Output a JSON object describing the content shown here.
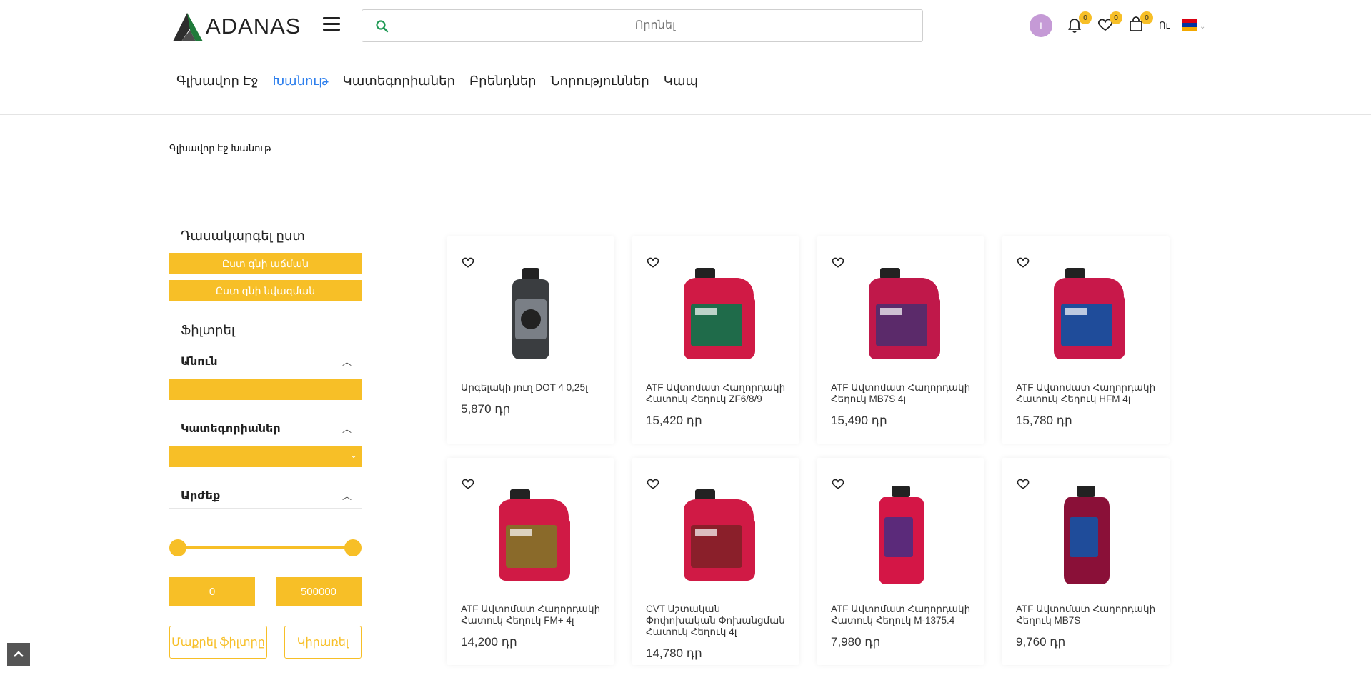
{
  "header": {
    "logo_text": "ADANAS",
    "search_placeholder": "Որոնել",
    "avatar_letter": "I",
    "notifications_count": "0",
    "wishlist_count": "0",
    "cart_count": "0",
    "currency": "Ու"
  },
  "nav": {
    "items": [
      "Գլխավոր Էջ",
      "Խանութ",
      "Կատեգորիաներ",
      "Բրենդներ",
      "Նորություններ",
      "Կապ"
    ],
    "active": "Խանութ"
  },
  "breadcrumb": "Գլխավոր Էջ  Խանութ",
  "sidebar": {
    "sort_title": "Դասակարգել ըստ",
    "sort_asc": "Ըստ գնի աճման",
    "sort_desc": "Ըստ գնի նվազման",
    "filter_title": "Ֆիլտրել",
    "name_label": "Անուն",
    "categories_label": "Կատեգորիաներ",
    "price_label": "Արժեք",
    "price_min": "0",
    "price_max": "500000",
    "clear_label": "Մաքրել ֆիլտրը",
    "apply_label": "Կիրառել"
  },
  "products": [
    {
      "name": "Արգելակի յուղ DOT 4 0,25լ",
      "price": "5,870 դր",
      "image": "small-bottle-dark"
    },
    {
      "name": "ATF Ավտոմատ Հաղորդակի Հատուկ Հեղուկ ZF6/8/9",
      "price": "15,420 դր",
      "image": "red-can-green-label"
    },
    {
      "name": "ATF Ավտոմատ Հաղորդակի Հեղուկ MB7S 4լ",
      "price": "15,490 դր",
      "image": "red-can-purple-label"
    },
    {
      "name": "ATF Ավտոմատ Հաղորդակի Հատուկ Հեղուկ HFM 4լ",
      "price": "15,780 դր",
      "image": "red-can-blue-label"
    },
    {
      "name": "ATF Ավտոմատ Հաղորդակի Հատուկ Հեղուկ FM+ 4լ",
      "price": "14,200 դր",
      "image": "red-can-gold-label"
    },
    {
      "name": "CVT Աշտական Փոփոխական Փոխանցման Հատուկ Հեղուկ 4լ",
      "price": "14,780 դր",
      "image": "red-can-red-label"
    },
    {
      "name": "ATF Ավտոմատ Հաղորդակի Հատուկ Հեղուկ M-1375.4",
      "price": "7,980 դր",
      "image": "red-bottle-1l"
    },
    {
      "name": "ATF Ավտոմատ Հաղորդակի Հեղուկ MB7S",
      "price": "9,760 դր",
      "image": "maroon-bottle-1l"
    }
  ],
  "colors": {
    "accent": "#f7bf27",
    "active_link": "#2f80ed",
    "avatar": "#c59ad6"
  }
}
